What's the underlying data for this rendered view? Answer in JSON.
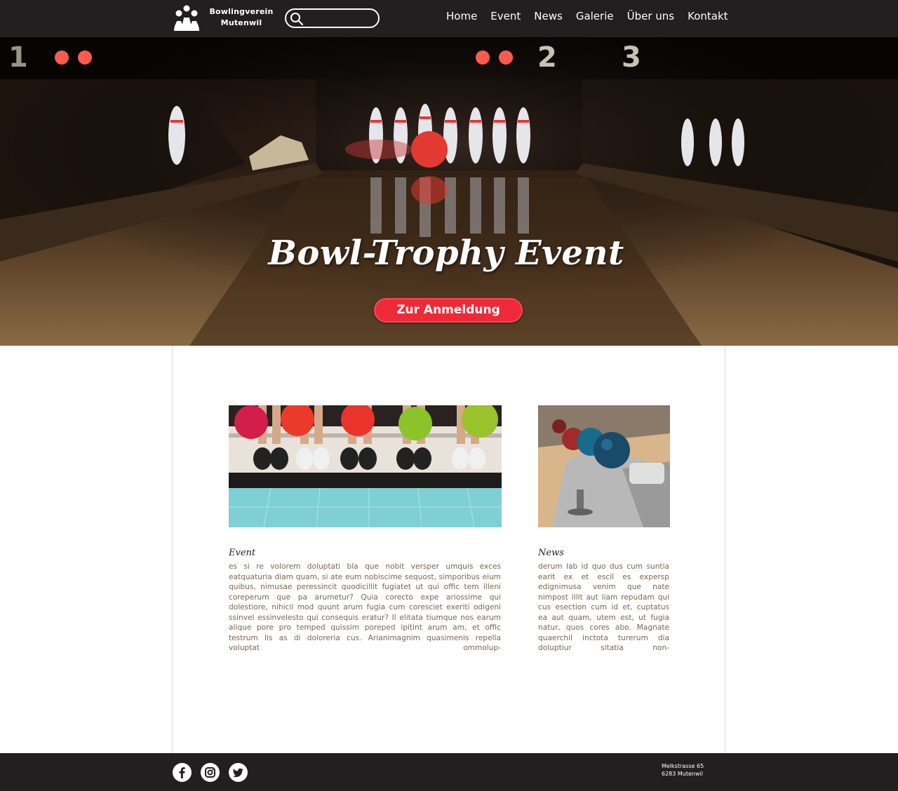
{
  "header": {
    "logo_line1": "Bowlingverein",
    "logo_line2": "Mutenwil",
    "search_placeholder": "",
    "nav": [
      "Home",
      "Event",
      "News",
      "Galerie",
      "Über uns",
      "Kontakt"
    ]
  },
  "hero": {
    "title": "Bowl-Trophy Event",
    "button_label": "Zur Anmeldung",
    "lane_numbers": [
      "1",
      "2",
      "3"
    ]
  },
  "cards": {
    "event": {
      "title": "Event",
      "text": "es si re volorem doluptati bla que nobit versper umquis exces eatquaturia diam quam, si ate eum nobiscime sequost, simporibus eium quibus, nimusae peressincit quodicillit fugiatet ut qui offic tem illeni coreperum que pa arumetur? Quia corecto expe ariossime qui dolestiore, nihicil mod quunt arum fugia cum coresciet exeriti odigeni ssinvel essinvelesto qui consequis eratur? Il elitata tiumque nos earum alique pore pro temped quissim poreped ipitint arum am, et offic testrum lis as di doloreria cus. Arianimagnim quasimenis repella voluptat ommolup-"
    },
    "news": {
      "title": "News",
      "text": "derum lab id quo dus cum suntia earit ex et escil es expersp edignimusa venim que nate nimpost illit aut liam repudam qui cus esection cum id et, cuptatus ea aut quam, utem est, ut fugia natur, quos cores abo. Magnate quaerchil inctota turerum dia doluptiur sitatia non-"
    }
  },
  "footer": {
    "address_line1": "Melkstrasse 65",
    "address_line2": "6283 Mutenwil",
    "social": [
      "facebook-icon",
      "instagram-icon",
      "twitter-icon"
    ]
  },
  "colors": {
    "header_bg": "#231f20",
    "accent_red": "#ee2a38",
    "text_brown": "#7a6650"
  }
}
